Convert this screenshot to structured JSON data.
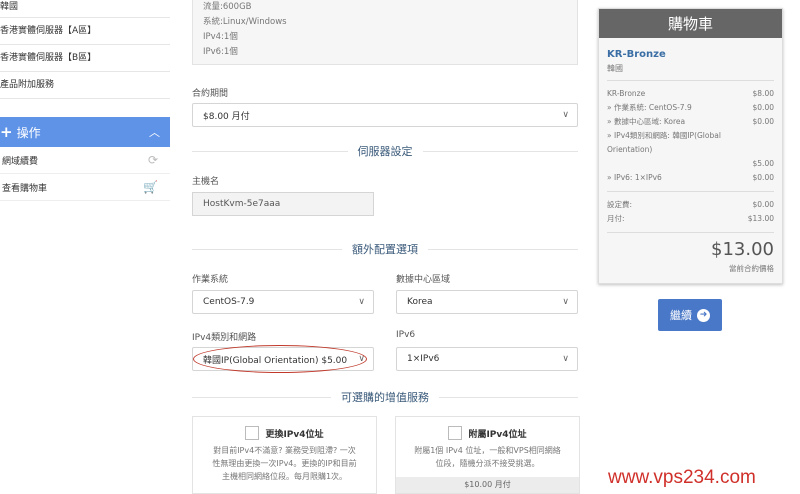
{
  "sidebar": {
    "items": [
      "韓國",
      "香港實體伺服器【A區】",
      "香港實體伺服器【B區】",
      "產品附加服務"
    ],
    "actions": {
      "title": "操作",
      "rows": [
        "網域續費",
        "查看購物車"
      ]
    }
  },
  "spec": [
    "流量:600GB",
    "系統:Linux/Windows",
    "IPv4:1個",
    "IPv6:1個"
  ],
  "billing": {
    "label": "合約期間",
    "value": "$8.00 月付"
  },
  "server_section": "伺服器設定",
  "hostname": {
    "label": "主機名",
    "value": "HostKvm-5e7aaa"
  },
  "config_section": "額外配置選項",
  "config": {
    "os": {
      "label": "作業系統",
      "value": "CentOS-7.9"
    },
    "dc": {
      "label": "數據中心區域",
      "value": "Korea"
    },
    "ipv4": {
      "label": "IPv4類別和網路",
      "value": "韓國IP(Global Orientation) $5.00"
    },
    "ipv6": {
      "label": "IPv6",
      "value": "1×IPv6"
    }
  },
  "addons_section": "可選購的增值服務",
  "addons": [
    {
      "title": "更換IPv4位址",
      "desc": [
        "對目前IPv4不滿意? 業務受到阻滯? 一次",
        "性無理由更換一次IPv4。更換的IP和目前",
        "主機相同網絡位段。每月限購1次。"
      ],
      "price": ""
    },
    {
      "title": "附屬IPv4位址",
      "desc": [
        "附屬1個 IPv4 位址，一般和VPS相同網絡",
        "位段，隨機分派不接受挑選。"
      ],
      "price": "$10.00 月付"
    }
  ],
  "cart": {
    "title": "購物車",
    "product": "KR-Bronze",
    "group": "韓國",
    "lines": [
      {
        "label": "KR-Bronze",
        "value": "$8.00"
      },
      {
        "label": "» 作業系統: CentOS-7.9",
        "value": "$0.00"
      },
      {
        "label": "» 數據中心區域: Korea",
        "value": "$0.00"
      },
      {
        "label": "» IPv4類別和網路: 韓國IP(Global",
        "value": ""
      },
      {
        "label": "Orientation)",
        "value": ""
      },
      {
        "label": "",
        "value": "$5.00"
      },
      {
        "label": "» IPv6: 1×IPv6",
        "value": "$0.00"
      }
    ],
    "setup": {
      "label": "設定費:",
      "value": "$0.00"
    },
    "monthly": {
      "label": "月付:",
      "value": "$13.00"
    },
    "total": "$13.00",
    "cycle": "當前合約價格"
  },
  "continue_label": "繼續",
  "watermark": "www.vps234.com"
}
